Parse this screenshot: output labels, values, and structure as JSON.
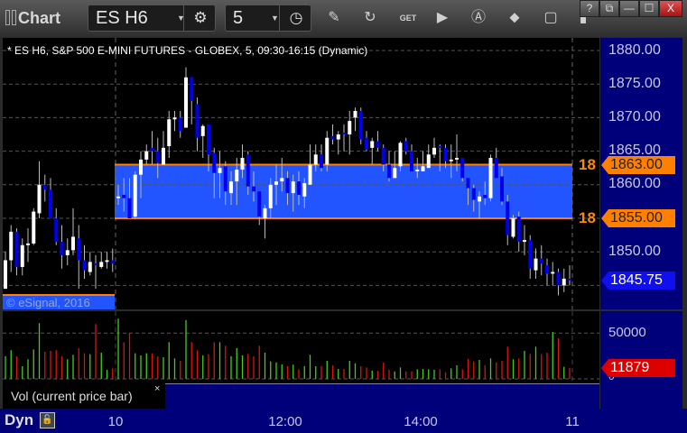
{
  "window": {
    "title": "Chart",
    "controls": [
      "?",
      "⧉",
      "—",
      "☐",
      "X"
    ]
  },
  "toolbar": {
    "symbol": "ES H6",
    "interval": "5",
    "icons": [
      "settings-gear-icon",
      "clock-icon",
      "pencil-draw-icon",
      "refresh-icon",
      "get-data-icon",
      "play-icon",
      "alert-icon",
      "link-icon",
      "comment-icon",
      "bookmark-icon"
    ]
  },
  "chart": {
    "header": "* ES H6, S&P 500 E-MINI FUTURES - GLOBEX, 5, 09:30-16:15 (Dynamic)",
    "copyright": "© eSignal, 2016",
    "price_labels": [
      "1880.00",
      "1875.00",
      "1870.00",
      "1865.00",
      "1860.00",
      "1850.00"
    ],
    "band": {
      "upper": 1863.0,
      "lower": 1855.0,
      "upper_label": "1863.00",
      "lower_label": "1855.00",
      "side_label": "18",
      "fill": "#2255ff",
      "line": "#ff8000"
    },
    "last_price": "1845.75",
    "colors": {
      "up_candle": "#ffffff",
      "down_candle": "#0000ee",
      "wick": "#bbbbbb",
      "axis_bg": "#00007a",
      "vol_up": "#44cc22",
      "vol_down": "#dd1111"
    }
  },
  "volume": {
    "label": "Vol (current price bar)",
    "close_symbol": "×",
    "axis_labels": [
      "50000",
      "0"
    ],
    "last_value": "11879"
  },
  "time_axis": {
    "labels": [
      "10",
      "12:00",
      "14:00",
      "11"
    ],
    "mode": "Dyn"
  },
  "chart_data": {
    "type": "candlestick",
    "prev_session_ohlc": [
      [
        1844.5,
        1850,
        1844.5,
        1848.75
      ],
      [
        1848.75,
        1854,
        1847,
        1853
      ],
      [
        1853,
        1853.5,
        1846.5,
        1847.75
      ],
      [
        1847.75,
        1852,
        1846.5,
        1851
      ],
      [
        1851,
        1853.5,
        1848.5,
        1851.25
      ],
      [
        1851.25,
        1856.5,
        1851,
        1856
      ],
      [
        1855.75,
        1863.5,
        1855,
        1860
      ],
      [
        1860,
        1861.5,
        1857.5,
        1859.25
      ],
      [
        1859.25,
        1861,
        1855,
        1855
      ],
      [
        1855,
        1856.5,
        1851,
        1851.5
      ],
      [
        1851.5,
        1854,
        1847.5,
        1849.5
      ],
      [
        1849.5,
        1852,
        1848,
        1850.25
      ],
      [
        1850.25,
        1856.5,
        1849.5,
        1852.25
      ],
      [
        1852,
        1854,
        1844.5,
        1848.75
      ],
      [
        1848.75,
        1851,
        1846,
        1847.25
      ],
      [
        1847,
        1850,
        1846.5,
        1848.5
      ],
      [
        1848.25,
        1849.5,
        1844.5,
        1848
      ],
      [
        1847.75,
        1850,
        1847.5,
        1848.5
      ],
      [
        1848.5,
        1850,
        1847.5,
        1848.75
      ],
      [
        1848.75,
        1850.5,
        1847,
        1848.25
      ]
    ],
    "session_ohlc": [
      [
        1858,
        1860,
        1857,
        1858.25
      ],
      [
        1858.5,
        1861,
        1856,
        1858
      ],
      [
        1858,
        1861,
        1855,
        1855
      ],
      [
        1855.25,
        1862,
        1855,
        1861.5
      ],
      [
        1861.5,
        1865,
        1858,
        1863.75
      ],
      [
        1863.75,
        1866,
        1863,
        1865
      ],
      [
        1865.5,
        1868,
        1863,
        1865
      ],
      [
        1865,
        1867,
        1861,
        1863.25
      ],
      [
        1863,
        1868,
        1863,
        1865.5
      ],
      [
        1865.75,
        1871,
        1864,
        1869.75
      ],
      [
        1869.75,
        1871,
        1868,
        1870
      ],
      [
        1870,
        1871,
        1867,
        1868
      ],
      [
        1868.5,
        1877.5,
        1868.5,
        1876
      ],
      [
        1876,
        1876,
        1869,
        1872.5
      ],
      [
        1872,
        1873,
        1865,
        1867
      ],
      [
        1867.25,
        1869,
        1864,
        1868.75
      ],
      [
        1869,
        1869,
        1862,
        1864.5
      ],
      [
        1864.75,
        1865.5,
        1858,
        1861.75
      ],
      [
        1861.75,
        1865,
        1858,
        1862.5
      ],
      [
        1862.75,
        1863.5,
        1857,
        1859
      ],
      [
        1858.75,
        1862,
        1857,
        1860.5
      ],
      [
        1860.5,
        1864,
        1857,
        1862.25
      ],
      [
        1862.25,
        1866,
        1861,
        1864
      ],
      [
        1864.5,
        1865,
        1858.5,
        1859.75
      ],
      [
        1859.75,
        1862,
        1857.5,
        1859
      ],
      [
        1859,
        1859,
        1854,
        1855.25
      ],
      [
        1855,
        1857,
        1852,
        1856.5
      ],
      [
        1856.5,
        1861,
        1855,
        1860
      ],
      [
        1860,
        1863,
        1857,
        1860.5
      ],
      [
        1860.5,
        1864,
        1859,
        1861
      ],
      [
        1861,
        1862,
        1857,
        1858.75
      ],
      [
        1858.75,
        1861.5,
        1856,
        1860.5
      ],
      [
        1860.5,
        1862,
        1857,
        1858.5
      ],
      [
        1858.25,
        1861,
        1856.5,
        1860.25
      ],
      [
        1860,
        1866,
        1860,
        1863
      ],
      [
        1863,
        1866,
        1862,
        1864.5
      ],
      [
        1864.5,
        1866,
        1862,
        1862.5
      ],
      [
        1863,
        1868,
        1862,
        1867
      ],
      [
        1867.25,
        1869,
        1866,
        1866.75
      ],
      [
        1866.75,
        1868,
        1864.5,
        1867.5
      ],
      [
        1867.75,
        1869,
        1865,
        1867.5
      ],
      [
        1867.5,
        1871,
        1864.5,
        1869.5
      ],
      [
        1870,
        1871.5,
        1868,
        1871
      ],
      [
        1871,
        1871.5,
        1866,
        1866.75
      ],
      [
        1867,
        1868,
        1865,
        1865.25
      ],
      [
        1865.5,
        1867,
        1863,
        1866.5
      ],
      [
        1866.5,
        1868,
        1865,
        1865.5
      ],
      [
        1865.5,
        1866,
        1862,
        1863
      ],
      [
        1863,
        1865,
        1860.5,
        1861
      ],
      [
        1861,
        1865,
        1861,
        1862.5
      ],
      [
        1862.75,
        1866.5,
        1862,
        1866.25
      ],
      [
        1866.5,
        1867,
        1864.5,
        1865
      ],
      [
        1865,
        1866,
        1862,
        1862
      ],
      [
        1862,
        1864,
        1861,
        1862.25
      ],
      [
        1862,
        1865,
        1862,
        1862.75
      ],
      [
        1862.5,
        1866,
        1862.5,
        1864.5
      ],
      [
        1864.5,
        1867,
        1864,
        1865.5
      ],
      [
        1865.75,
        1866,
        1862,
        1865.5
      ],
      [
        1865.5,
        1866,
        1862.5,
        1863.5
      ],
      [
        1863.5,
        1866,
        1861,
        1863.75
      ],
      [
        1863.75,
        1867.5,
        1862,
        1864
      ],
      [
        1864,
        1864,
        1860.5,
        1861
      ],
      [
        1861,
        1861,
        1857,
        1859.5
      ],
      [
        1859.5,
        1860,
        1856,
        1857.75
      ],
      [
        1857.5,
        1859,
        1855,
        1858.25
      ],
      [
        1858.5,
        1860.5,
        1857,
        1858
      ],
      [
        1858,
        1864.5,
        1857.5,
        1864
      ],
      [
        1864,
        1865.5,
        1861,
        1861
      ],
      [
        1861.25,
        1862.5,
        1857,
        1857.5
      ],
      [
        1857.5,
        1858.5,
        1851,
        1852.5
      ],
      [
        1852.25,
        1855.5,
        1852,
        1855
      ],
      [
        1855.25,
        1856,
        1850,
        1851.5
      ],
      [
        1851.5,
        1854,
        1849.5,
        1851.75
      ],
      [
        1851.75,
        1852.5,
        1846,
        1847.5
      ],
      [
        1847.25,
        1850.5,
        1846,
        1849
      ],
      [
        1849,
        1851,
        1846.5,
        1848.25
      ],
      [
        1848,
        1849,
        1845,
        1846.75
      ],
      [
        1846.75,
        1848.5,
        1845,
        1847
      ],
      [
        1847,
        1847.5,
        1843.5,
        1845
      ],
      [
        1845,
        1847.5,
        1844,
        1846
      ],
      [
        1846,
        1848,
        1845,
        1845.75
      ]
    ],
    "volume": [
      24700,
      31300,
      24700,
      13800,
      21400,
      32200,
      60900,
      29600,
      30600,
      31300,
      24700,
      21400,
      26300,
      33600,
      28000,
      27000,
      59900,
      28600,
      9900,
      11500,
      65800,
      40100,
      50000,
      28000,
      25700,
      28000,
      28000,
      24700,
      23700,
      40100,
      22400,
      19700,
      64200,
      40100,
      31300,
      25700,
      27000,
      40100,
      40100,
      36200,
      24700,
      33600,
      25700,
      27300,
      24700,
      36200,
      28600,
      19100,
      18100,
      15800,
      13800,
      15500,
      10500,
      13800,
      26300,
      13800,
      13800,
      19700,
      14800,
      10900,
      10900,
      19700,
      17100,
      13800,
      12500,
      8900,
      8900,
      17800,
      9900,
      8200,
      12500,
      8200,
      8200,
      10500,
      10900,
      10500,
      9900,
      10500,
      7200,
      11500,
      14800,
      10500,
      22000,
      19100,
      20700,
      14800,
      22400,
      18100,
      19700,
      35200,
      21400,
      22400,
      30600,
      27300,
      35200,
      27000,
      28600,
      51300,
      44400,
      13200,
      11879
    ],
    "price_range": [
      1843,
      1882
    ],
    "session": "09:30-16:15",
    "interval_minutes": 5,
    "grid": true
  }
}
